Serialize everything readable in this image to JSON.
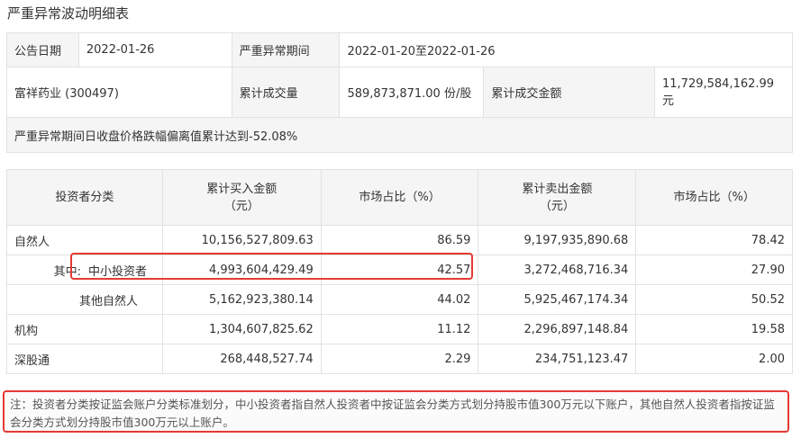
{
  "title": "严重异常波动明细表",
  "info": {
    "announce_date_label": "公告日期",
    "announce_date": "2022-01-26",
    "period_label": "严重异常期间",
    "period": "2022-01-20至2022-01-26",
    "stock": "富祥药业 (300497)",
    "volume_label": "累计成交量",
    "volume": "589,873,871.00 份/股",
    "amount_label": "累计成交金额",
    "amount": "11,729,584,162.99 元",
    "deviation": "严重异常期间日收盘价格跌幅偏离值累计达到-52.08%"
  },
  "stats": {
    "headers": [
      "投资者分类",
      "累计买入金额\n（元）",
      "市场占比（%）",
      "累计卖出金额\n（元）",
      "市场占比（%）"
    ],
    "rows": [
      {
        "category": "自然人",
        "buy": "10,156,527,809.63",
        "buy_pct": "86.59",
        "sell": "9,197,935,890.68",
        "sell_pct": "78.42"
      },
      {
        "prefix": "其中:",
        "category": "中小投资者",
        "buy": "4,993,604,429.49",
        "buy_pct": "42.57",
        "sell": "3,272,468,716.34",
        "sell_pct": "27.90"
      },
      {
        "category": "其他自然人",
        "buy": "5,162,923,380.14",
        "buy_pct": "44.02",
        "sell": "5,925,467,174.34",
        "sell_pct": "50.52"
      },
      {
        "category": "机构",
        "buy": "1,304,607,825.62",
        "buy_pct": "11.12",
        "sell": "2,296,897,148.84",
        "sell_pct": "19.58"
      },
      {
        "category": "深股通",
        "buy": "268,448,527.74",
        "buy_pct": "2.29",
        "sell": "234,751,123.47",
        "sell_pct": "2.00"
      }
    ]
  },
  "note": "注：投资者分类按证监会账户分类标准划分，中小投资者指自然人投资者中按证监会分类方式划分持股市值300万元以下账户，其他自然人投资者指按证监会分类方式划分持股市值300万元以上账户。",
  "highlight_color": "#e53935"
}
